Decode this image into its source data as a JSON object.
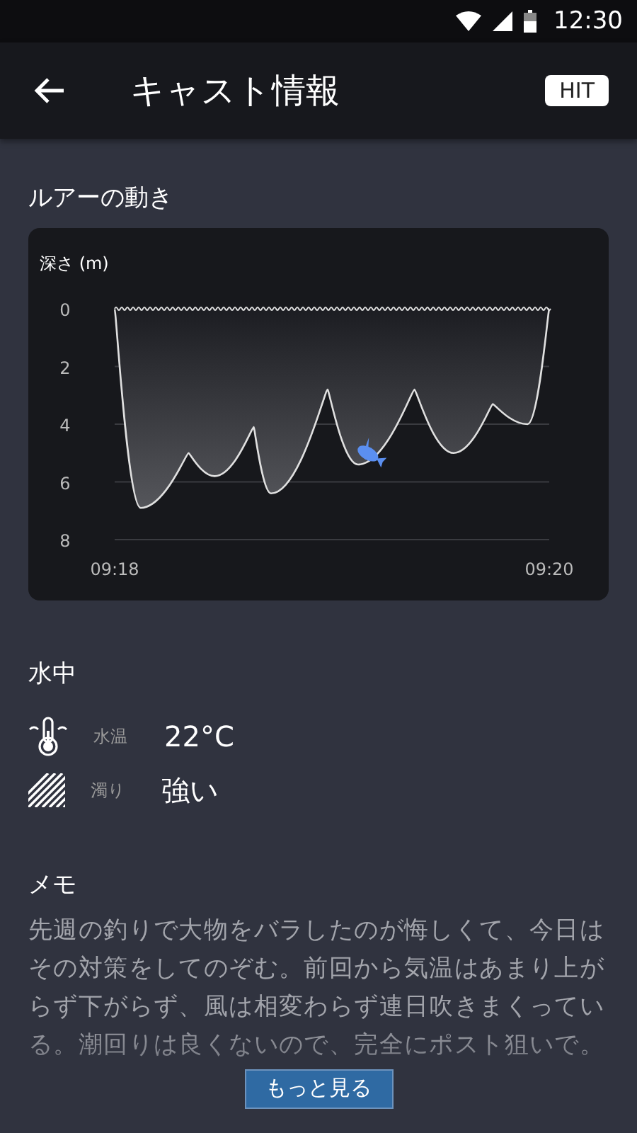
{
  "status_bar": {
    "time": "12:30"
  },
  "app_bar": {
    "title": "キャスト情報",
    "badge": "HIT"
  },
  "lure_section": {
    "title": "ルアーの動き",
    "chart_data": {
      "type": "area",
      "ylabel": "深さ (m)",
      "x": [
        558,
        558.12,
        558.34,
        558.46,
        558.64,
        558.72,
        558.98,
        559.12,
        559.38,
        559.56,
        559.74,
        559.9,
        560
      ],
      "series": [
        {
          "color": "#e0e0e0",
          "values": [
            0,
            6.9,
            5.0,
            5.8,
            4.1,
            6.4,
            2.8,
            5.4,
            2.8,
            5.0,
            3.3,
            4.0,
            0
          ]
        }
      ],
      "grid": true,
      "ylim": [
        8,
        0
      ],
      "yticks": [
        0,
        2,
        4,
        6,
        8
      ],
      "xlim": [
        558,
        560
      ],
      "xticks": [
        {
          "value": 558,
          "label": "09:18"
        },
        {
          "value": 560,
          "label": "09:20"
        }
      ]
    }
  },
  "water_section": {
    "title": "水中",
    "rows": [
      {
        "kind": "temperature",
        "label": "水温",
        "value": "22°C"
      },
      {
        "kind": "turbidity",
        "label": "濁り",
        "value": "強い"
      }
    ]
  },
  "memo_section": {
    "title": "メモ",
    "text": "先週の釣りで大物をバラしたのが悔しくて、今日はその対策をしてのぞむ。前回から気温はあまり上がらず下がらず、風は相変わらず連日吹きまくっている。潮回りは良くないので、完全にポスト狙いで。",
    "more_button": "もっと見る"
  }
}
